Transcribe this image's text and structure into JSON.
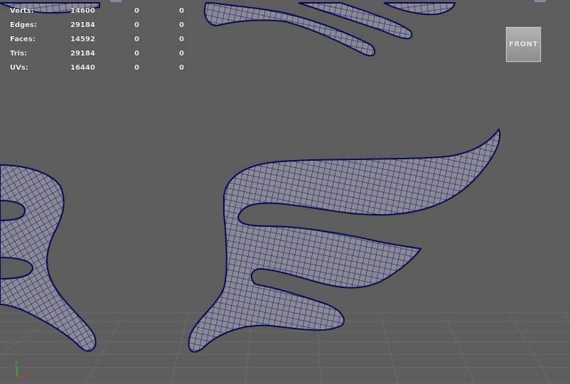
{
  "stats": {
    "rows": [
      {
        "label": "Verts:",
        "v1": "14600",
        "v2": "0",
        "v3": "0"
      },
      {
        "label": "Edges:",
        "v1": "29184",
        "v2": "0",
        "v3": "0"
      },
      {
        "label": "Faces:",
        "v1": "14592",
        "v2": "0",
        "v3": "0"
      },
      {
        "label": "Tris:",
        "v1": "29184",
        "v2": "0",
        "v3": "0"
      },
      {
        "label": "UVs:",
        "v1": "16440",
        "v2": "0",
        "v3": "0"
      }
    ]
  },
  "viewcube": {
    "label": "FRONT"
  },
  "axis": {
    "y_label": "y",
    "x_label": "x"
  },
  "colors": {
    "viewport_bg": "#5d5d5d",
    "mesh_fill": "#888891",
    "wire": "#0b0b60",
    "grid": "#6b6b6b",
    "axis_y": "#2fbf2f",
    "axis_x": "#d23030"
  }
}
